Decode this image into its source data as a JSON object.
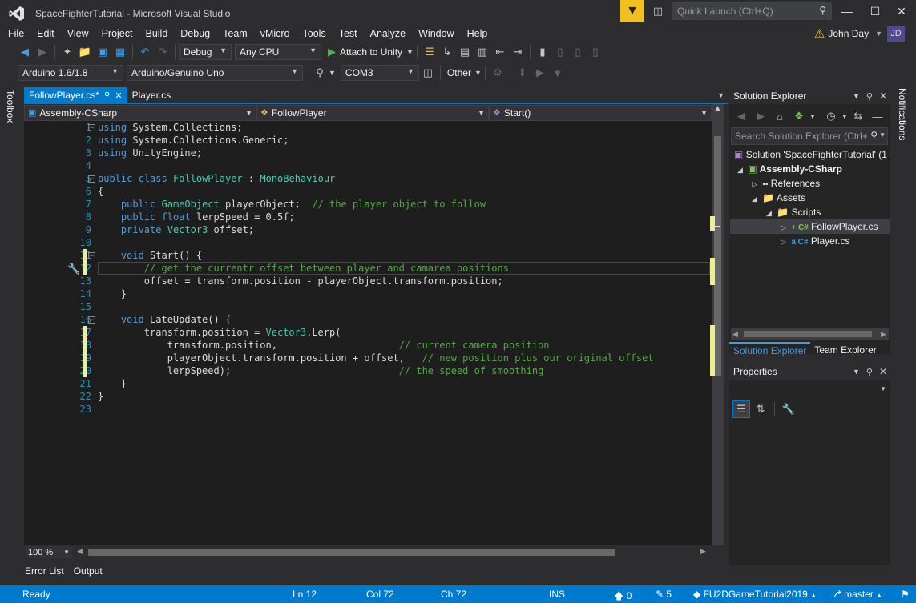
{
  "window": {
    "title": "SpaceFighterTutorial - Microsoft Visual Studio",
    "quick_launch_placeholder": "Quick Launch (Ctrl+Q)",
    "user_name": "John Day",
    "avatar_initials": "JD"
  },
  "menu": [
    "File",
    "Edit",
    "View",
    "Project",
    "Build",
    "Debug",
    "Team",
    "vMicro",
    "Tools",
    "Test",
    "Analyze",
    "Window",
    "Help"
  ],
  "toolbar": {
    "config": "Debug",
    "platform": "Any CPU",
    "attach_label": "Attach to Unity",
    "arduino_version": "Arduino 1.6/1.8",
    "board": "Arduino/Genuino Uno",
    "port": "COM3",
    "other_label": "Other"
  },
  "toolbox_label": "Toolbox",
  "notifications_label": "Notifications",
  "doc_tabs": [
    {
      "label": "FollowPlayer.cs*",
      "active": true
    },
    {
      "label": "Player.cs",
      "active": false
    }
  ],
  "navbar": {
    "project": "Assembly-CSharp",
    "class": "FollowPlayer",
    "member": "Start()"
  },
  "editor": {
    "line_numbers": [
      "1",
      "2",
      "3",
      "4",
      "5",
      "6",
      "7",
      "8",
      "9",
      "10",
      "11",
      "12",
      "13",
      "14",
      "15",
      "16",
      "17",
      "18",
      "19",
      "20",
      "21",
      "22",
      "23"
    ],
    "zoom": "100 %"
  },
  "bottom_tabs": [
    "Error List",
    "Output"
  ],
  "solution_explorer": {
    "title": "Solution Explorer",
    "search_placeholder": "Search Solution Explorer (Ctrl+",
    "items": [
      "Solution 'SpaceFighterTutorial' (1",
      "Assembly-CSharp",
      "References",
      "Assets",
      "Scripts",
      "FollowPlayer.cs",
      "Player.cs"
    ],
    "tabs": [
      "Solution Explorer",
      "Team Explorer"
    ]
  },
  "properties": {
    "title": "Properties"
  },
  "status": {
    "ready": "Ready",
    "ln": "Ln 12",
    "col": "Col 72",
    "ch": "Ch 72",
    "ins": "INS",
    "up_count": "0",
    "edit_count": "5",
    "repo": "FU2DGameTutorial2019",
    "branch": "master"
  },
  "colors": {
    "accent": "#007acc",
    "background": "#2d2d30",
    "editor": "#1e1e1e"
  }
}
